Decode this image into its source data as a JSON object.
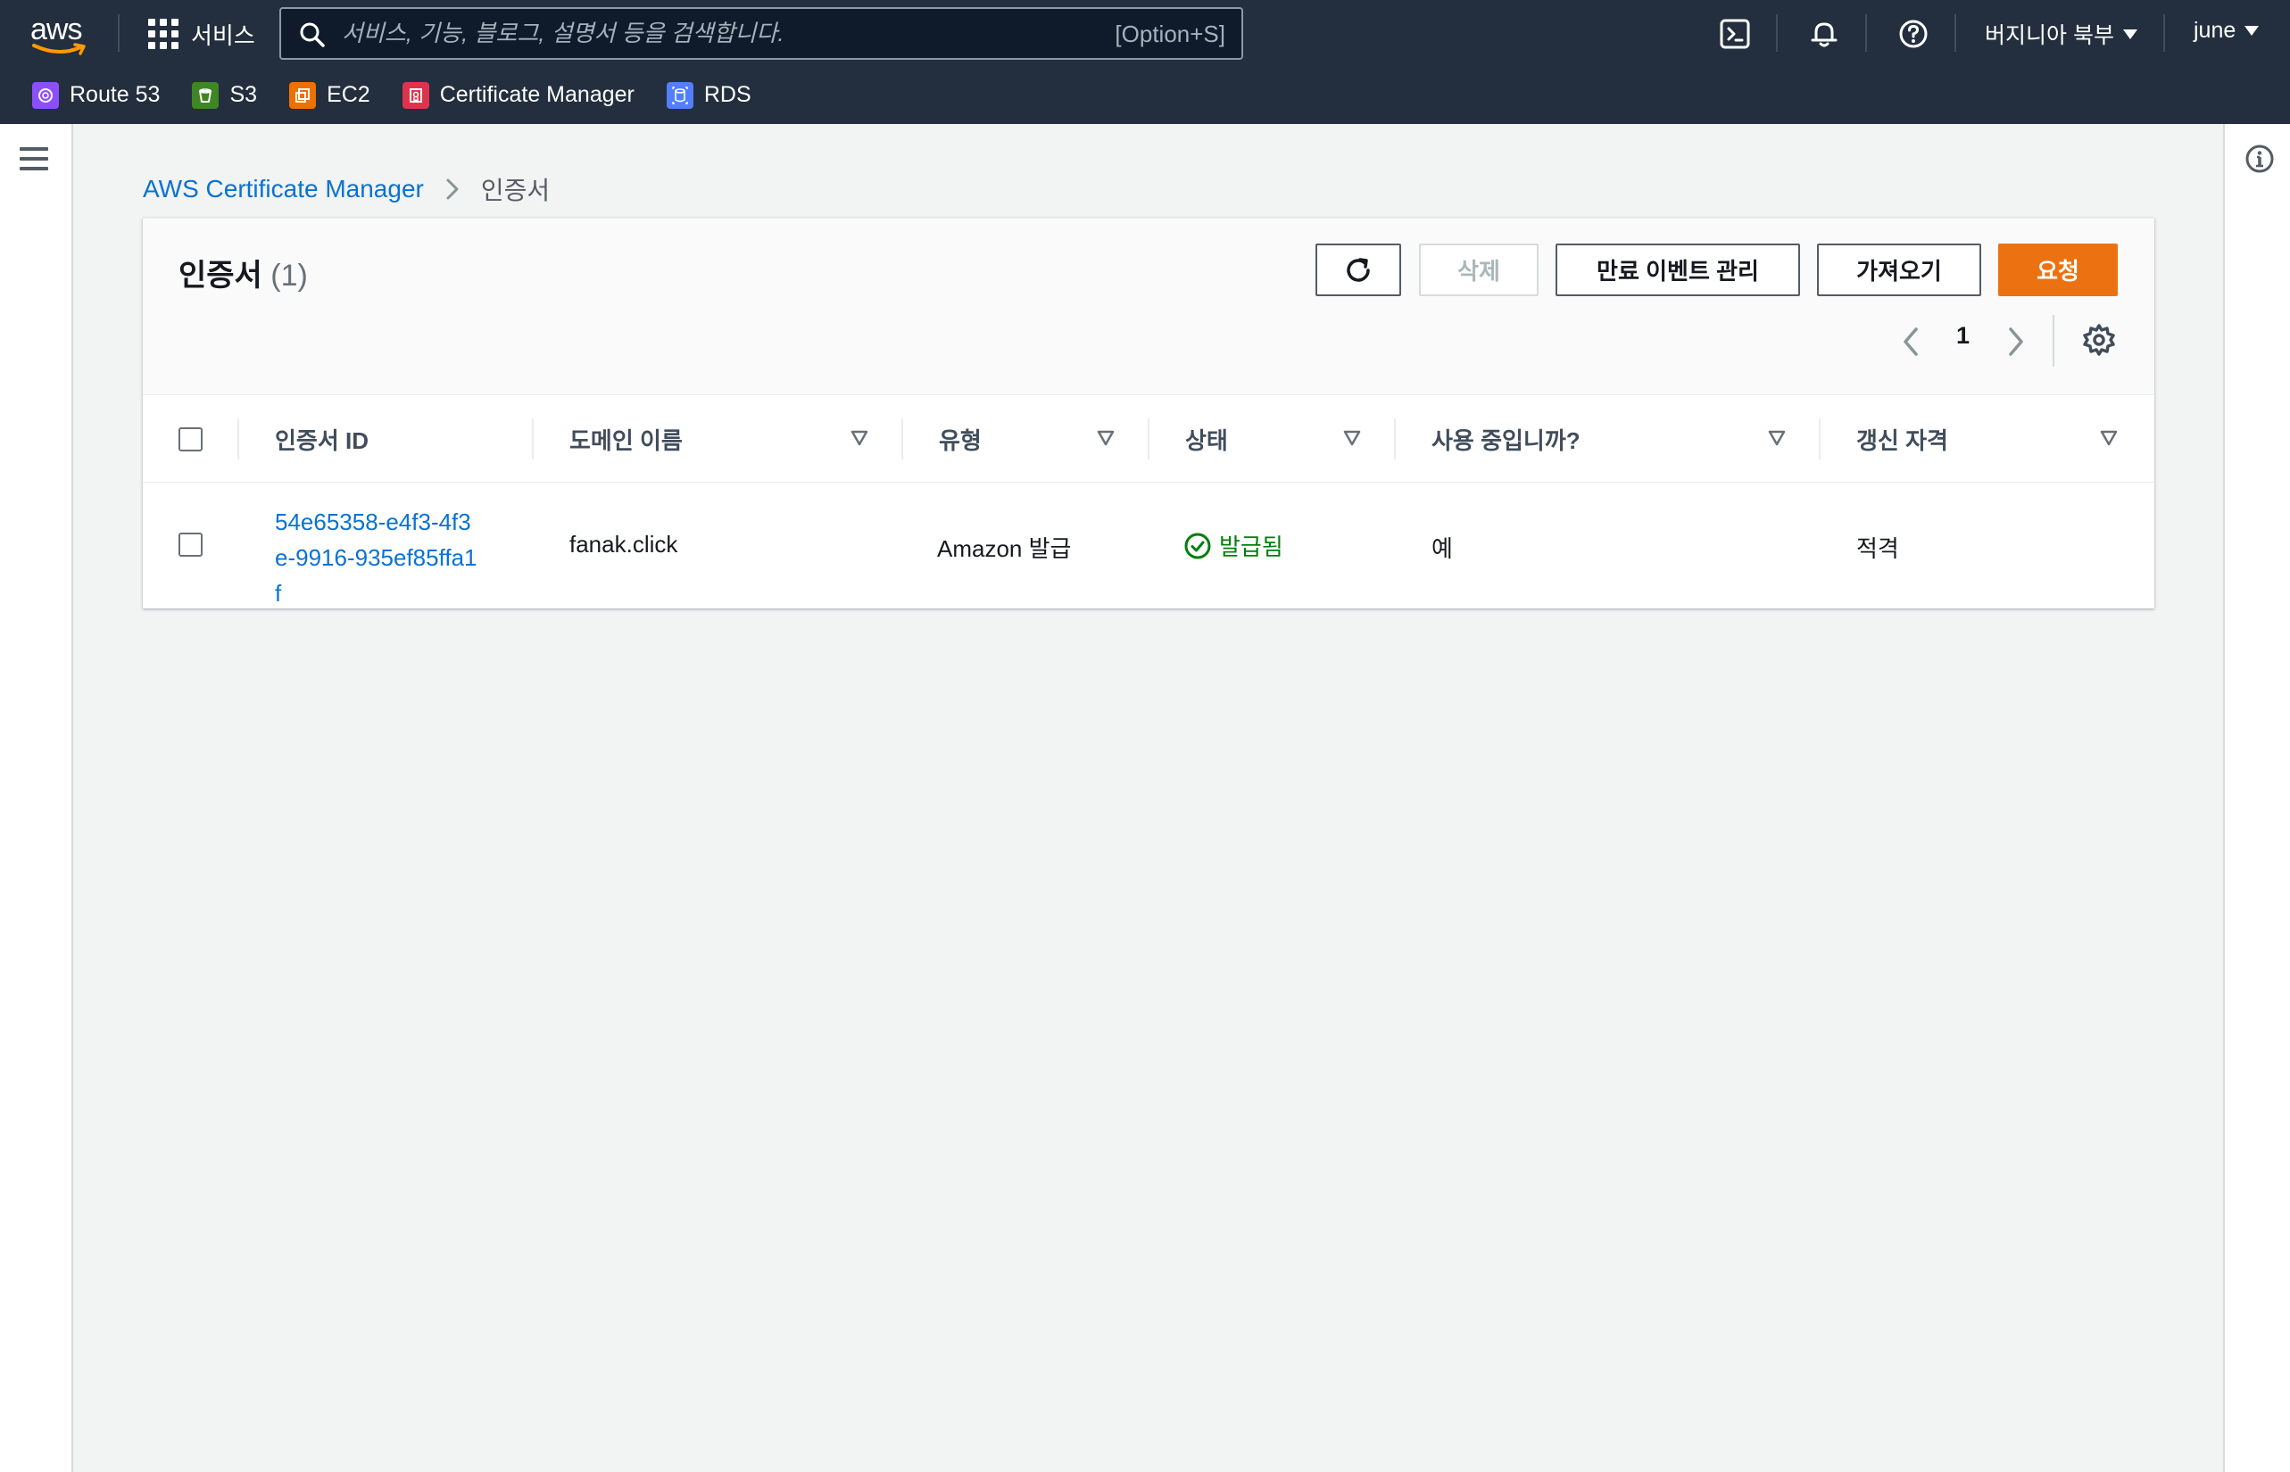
{
  "topnav": {
    "logo": "aws",
    "services_label": "서비스",
    "search_placeholder": "서비스, 기능, 블로그, 설명서 등을 검색합니다.",
    "search_shortcut": "[Option+S]",
    "region": "버지니아 북부",
    "user": "june"
  },
  "favorites": [
    {
      "label": "Route 53",
      "color": "#8c4fff"
    },
    {
      "label": "S3",
      "color": "#3f8624"
    },
    {
      "label": "EC2",
      "color": "#ed7100"
    },
    {
      "label": "Certificate Manager",
      "color": "#dd344c"
    },
    {
      "label": "RDS",
      "color": "#527fff"
    }
  ],
  "breadcrumb": {
    "root": "AWS Certificate Manager",
    "current": "인증서"
  },
  "panel": {
    "title": "인증서",
    "count": "(1)",
    "buttons": {
      "delete": "삭제",
      "expiry_events": "만료 이벤트 관리",
      "import": "가져오기",
      "request": "요청"
    },
    "page": "1"
  },
  "table": {
    "headers": {
      "cert_id": "인증서 ID",
      "domain": "도메인 이름",
      "type": "유형",
      "status": "상태",
      "in_use": "사용 중입니까?",
      "renewal": "갱신 자격"
    },
    "rows": [
      {
        "cert_id": "54e65358-e4f3-4f3e-9916-935ef85ffa1f",
        "domain": "fanak.click",
        "type": "Amazon 발급",
        "status": "발급됨",
        "in_use": "예",
        "renewal": "적격"
      }
    ]
  },
  "colors": {
    "nav_bg": "#232f3e",
    "link": "#0972d3",
    "primary": "#ec7211",
    "success": "#037f0c"
  }
}
